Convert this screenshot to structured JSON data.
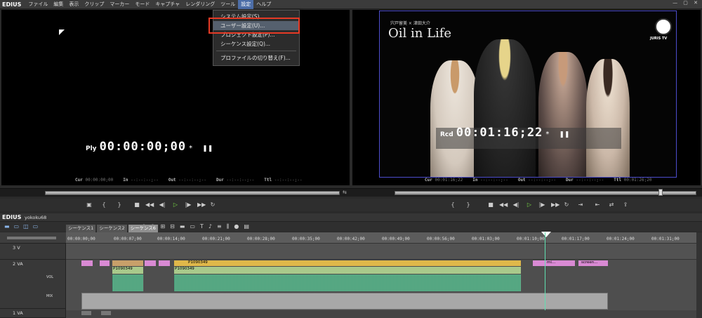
{
  "menubar": {
    "logo": "EDIUS",
    "items": [
      "ファイル",
      "編集",
      "表示",
      "クリップ",
      "マーカー",
      "モード",
      "キャプチャ",
      "レンダリング",
      "ツール",
      "設定",
      "ヘルプ"
    ],
    "active_index": 9
  },
  "dropdown": {
    "items": [
      "システム設定(S)...",
      "ユーザー設定(U)...",
      "プロジェクト設定(P)...",
      "シーケンス設定(Q)..."
    ],
    "last_item": "プロファイルの切り替え(F)...",
    "highlighted_index": 1
  },
  "player": {
    "label": "Ply",
    "timecode": "00:00:00;00",
    "cur_label": "Cur",
    "cur": "00:00:00;00",
    "in_label": "In",
    "in": "--:--:--;--",
    "out_label": "Out",
    "out": "--:--:--;--",
    "dur_label": "Dur",
    "dur": "--:--:--;--",
    "ttl_label": "Ttl",
    "ttl": "--:--:--;--"
  },
  "recorder": {
    "label": "Rcd",
    "timecode": "00:01:16;22",
    "cur_label": "Cur",
    "cur": "00:01:16;22",
    "in_label": "In",
    "in": "--:--:--;--",
    "out_label": "Out",
    "out": "--:--:--;--",
    "dur_label": "Dur",
    "dur": "--:--:--;--",
    "ttl_label": "Ttl",
    "ttl": "00:01:26;20"
  },
  "video": {
    "credit": "宍戸留美 × 津田大介",
    "title": "Oil in Life",
    "logo_text": "JURIS TV"
  },
  "timeline": {
    "logo": "EDIUS",
    "project": "yokoku68",
    "tabs": [
      "シーケンス1",
      "シーケンス2",
      "シーケンス6"
    ],
    "active_tab": 2,
    "ruler": [
      "00:00:00;00",
      "00:00:07;00",
      "00:00:14;00",
      "00:00:21;00",
      "00:00:28;00",
      "00:00:35;00",
      "00:00:42;00",
      "00:00:49;00",
      "00:00:56;00",
      "00:01:03;00",
      "00:01:10;00",
      "00:01:17;00",
      "00:01:24;00",
      "00:01:31;00"
    ],
    "tracks": {
      "v3": "3 V",
      "va2": "2 VA",
      "vol": "VOL",
      "mix": "MIX",
      "va1": "1 VA"
    },
    "clips": {
      "c1": "P1090349",
      "c2": "P1090349",
      "c3": "P1090349",
      "c4": "P1090349",
      "c5": "mi...",
      "c6": "screen..."
    }
  },
  "colors": {
    "accent": "#4d6ea8",
    "highlight": "#e53a25",
    "clip_video": "#d98ad4",
    "clip_audio": "#5aa87a",
    "clip_green": "#a9c98b"
  }
}
